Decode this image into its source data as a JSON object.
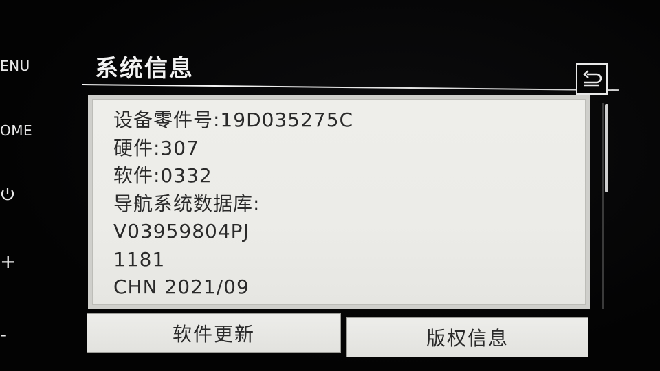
{
  "side_buttons": {
    "menu": "ENU",
    "home": "OME",
    "power_icon": "power-icon",
    "plus": "+",
    "minus": "-"
  },
  "header": {
    "title": "系统信息",
    "back_icon": "back-arrow-icon"
  },
  "info": {
    "lines": [
      "设备零件号:19D035275C",
      "硬件:307",
      "软件:0332",
      "导航系统数据库:",
      "V03959804PJ",
      "1181",
      "CHN 2021/09"
    ]
  },
  "buttons": {
    "software_update": "软件更新",
    "copyright_info": "版权信息"
  },
  "colors": {
    "background": "#050505",
    "panel": "#ecece8",
    "text_dark": "#2a2a2a",
    "text_light": "#f2f2f2"
  }
}
